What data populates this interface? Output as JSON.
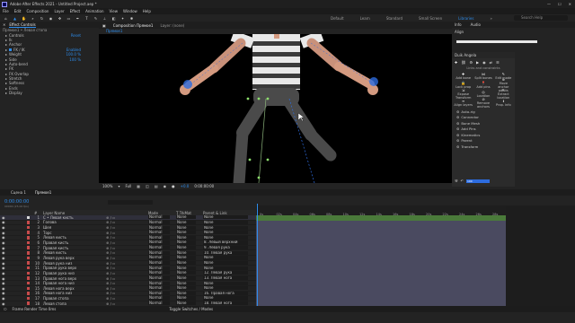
{
  "app": {
    "title": "Adobe After Effects 2021 - Untitled Project.aep *",
    "win_min": "—",
    "win_max": "☐",
    "win_close": "✕"
  },
  "menu": [
    "File",
    "Edit",
    "Composition",
    "Layer",
    "Effect",
    "Animation",
    "View",
    "Window",
    "Help"
  ],
  "workspaces": {
    "items": [
      "Default",
      "Learn",
      "Standard",
      "Small Screen",
      "Libraries"
    ],
    "active_index": 4,
    "more": "»",
    "search_placeholder": "Search Help"
  },
  "effect_controls": {
    "tab_label": "Effect Controls",
    "layer": "Прямое1 • Левая стопа",
    "rows": [
      {
        "name": "Controls",
        "value": "Reset"
      },
      {
        "name": "Ik",
        "value": ""
      },
      {
        "name": "Anchor",
        "value": ""
      },
      {
        "name": "FK / IK",
        "value": "Enabled"
      },
      {
        "name": "Weight",
        "value": "100.0 %"
      },
      {
        "name": "Side",
        "value": "100 %"
      },
      {
        "name": "Auto-bend",
        "value": ""
      },
      {
        "name": "FK",
        "value": ""
      },
      {
        "name": "FK Overlap",
        "value": ""
      },
      {
        "name": "Stretch",
        "value": ""
      },
      {
        "name": "Softness",
        "value": ""
      },
      {
        "name": "Ends",
        "value": ""
      },
      {
        "name": "Display",
        "value": ""
      }
    ]
  },
  "composition": {
    "tab_label": "Composition Прямое1",
    "sub_tab": "Прямое1",
    "layer_tab": "Layer: (none)",
    "zoom": "100%",
    "resolution": "Full",
    "timecode": "0:00:00:00",
    "exposure": "+0.0"
  },
  "right_panel": {
    "info_title": "Info",
    "audio_title": "Audio",
    "align_title": "Align",
    "duik_title": "Duik Angela",
    "section_title": "Links and constraints",
    "buttons": [
      {
        "label": "Add bone",
        "icon": "✚"
      },
      {
        "label": "Split bones",
        "icon": "⋈"
      },
      {
        "label": "Edit mode",
        "icon": "✎"
      },
      {
        "label": "Lock prop",
        "icon": "🔒"
      },
      {
        "label": "Add pins",
        "icon": "📍"
      },
      {
        "label": "Move anchor points",
        "icon": "⊕"
      },
      {
        "label": "Expose Transform",
        "icon": "⇲"
      },
      {
        "label": "Location",
        "icon": "◎"
      },
      {
        "label": "Extract location",
        "icon": "⇱"
      },
      {
        "label": "Align layers",
        "icon": "≡"
      },
      {
        "label": "Remove anchors",
        "icon": "⊘"
      },
      {
        "label": "Prop. info",
        "icon": "ℹ"
      }
    ],
    "list": [
      "Auto-rig",
      "Connector",
      "Bone Mesh",
      "Add Pins",
      "Kinematics",
      "Parent",
      "Transform"
    ],
    "zoom_value": "100"
  },
  "timeline": {
    "tabs": [
      "Сцена 1",
      "Прямое1"
    ],
    "active_tab": 1,
    "timecode": "0:00:00:00",
    "fps": "00000 (25.00 fps)",
    "columns": [
      "#",
      "Layer Name",
      "Mode",
      "T TrkMat",
      "Parent & Link"
    ],
    "ruler_ticks": [
      "0s",
      "02s",
      "04s",
      "06s",
      "08s",
      "10s",
      "12s",
      "14s",
      "16s",
      "18s",
      "20s",
      "22s",
      "24s",
      "26s",
      "28s"
    ],
    "frame_render": "Frame Render Time 0ms",
    "toggle": "Toggle Switches / Modes",
    "layers": [
      {
        "n": "1",
        "name": "С • Левая кисть",
        "mode": "Normal",
        "trk": "None",
        "parent": "None",
        "label": "#d9d9d9"
      },
      {
        "n": "2",
        "name": "Голова",
        "mode": "Normal",
        "trk": "None",
        "parent": "None",
        "label": "#c84b4b"
      },
      {
        "n": "3",
        "name": "Шея",
        "mode": "Normal",
        "trk": "None",
        "parent": "None",
        "label": "#c84b4b"
      },
      {
        "n": "4",
        "name": "Торс",
        "mode": "Normal",
        "trk": "None",
        "parent": "None",
        "label": "#c84b4b"
      },
      {
        "n": "5",
        "name": "Левая кисть",
        "mode": "Normal",
        "trk": "None",
        "parent": "None",
        "label": "#c84b4b"
      },
      {
        "n": "6",
        "name": "Правая кисть",
        "mode": "Normal",
        "trk": "None",
        "parent": "8. Левый верхний",
        "label": "#c84b4b"
      },
      {
        "n": "7",
        "name": "Правая кисть",
        "mode": "Normal",
        "trk": "None",
        "parent": "9. Левая рука",
        "label": "#c84b4b"
      },
      {
        "n": "8",
        "name": "Левая кисть",
        "mode": "Normal",
        "trk": "None",
        "parent": "10. Левая рука",
        "label": "#c84b4b"
      },
      {
        "n": "9",
        "name": "Левая рука верх",
        "mode": "Normal",
        "trk": "None",
        "parent": "None",
        "label": "#c84b4b"
      },
      {
        "n": "10",
        "name": "Левая рука низ",
        "mode": "Normal",
        "trk": "None",
        "parent": "None",
        "label": "#c84b4b"
      },
      {
        "n": "11",
        "name": "Правая рука верх",
        "mode": "Normal",
        "trk": "None",
        "parent": "None",
        "label": "#c84b4b"
      },
      {
        "n": "12",
        "name": "Правая рука низ",
        "mode": "Normal",
        "trk": "None",
        "parent": "12. Левая рука",
        "label": "#c84b4b"
      },
      {
        "n": "13",
        "name": "Правая нога верх",
        "mode": "Normal",
        "trk": "None",
        "parent": "13. Левая нога",
        "label": "#c84b4b"
      },
      {
        "n": "14",
        "name": "Правая нога низ",
        "mode": "Normal",
        "trk": "None",
        "parent": "None",
        "label": "#c84b4b"
      },
      {
        "n": "15",
        "name": "Левая нога верх",
        "mode": "Normal",
        "trk": "None",
        "parent": "None",
        "label": "#c84b4b"
      },
      {
        "n": "16",
        "name": "Левая нога низ",
        "mode": "Normal",
        "trk": "None",
        "parent": "16. Правая нога",
        "label": "#c84b4b"
      },
      {
        "n": "17",
        "name": "Правая стопа",
        "mode": "Normal",
        "trk": "None",
        "parent": "None",
        "label": "#c84b4b"
      },
      {
        "n": "18",
        "name": "Левая стопа",
        "mode": "Normal",
        "trk": "None",
        "parent": "18. Левая нога",
        "label": "#c84b4b"
      }
    ]
  }
}
